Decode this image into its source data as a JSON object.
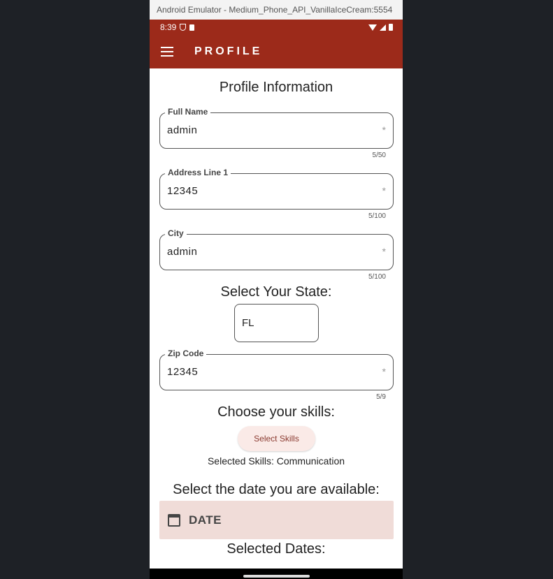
{
  "window": {
    "title": "Android Emulator - Medium_Phone_API_VanillaIceCream:5554"
  },
  "statusbar": {
    "time": "8:39"
  },
  "appbar": {
    "title": "PROFILE"
  },
  "profile": {
    "heading": "Profile Information"
  },
  "fields": {
    "full_name": {
      "label": "Full Name",
      "value": "admin",
      "required_mark": "*",
      "counter": "5/50"
    },
    "address1": {
      "label": "Address Line 1",
      "value": "12345",
      "required_mark": "*",
      "counter": "5/100"
    },
    "city": {
      "label": "City",
      "value": "admin",
      "required_mark": "*",
      "counter": "5/100"
    },
    "zip": {
      "label": "Zip Code",
      "value": "12345",
      "required_mark": "*",
      "counter": "5/9"
    }
  },
  "state": {
    "heading": "Select Your State:",
    "value": "FL"
  },
  "skills": {
    "heading": "Choose your skills:",
    "button_label": "Select Skills",
    "selected_text": "Selected Skills: Communication"
  },
  "availability": {
    "heading": "Select the date you are available:",
    "date_button_label": "DATE",
    "selected_dates_heading": "Selected Dates:"
  },
  "colors": {
    "primary": "#9c2a1a",
    "button_tint": "#faeae7",
    "date_bg": "#f0dcd8"
  },
  "icons": {
    "menu": "menu-icon",
    "calendar": "calendar-icon",
    "shield": "shield-icon",
    "sim": "sim-card-icon",
    "wifi": "wifi-icon",
    "signal": "signal-icon",
    "battery": "battery-icon"
  }
}
